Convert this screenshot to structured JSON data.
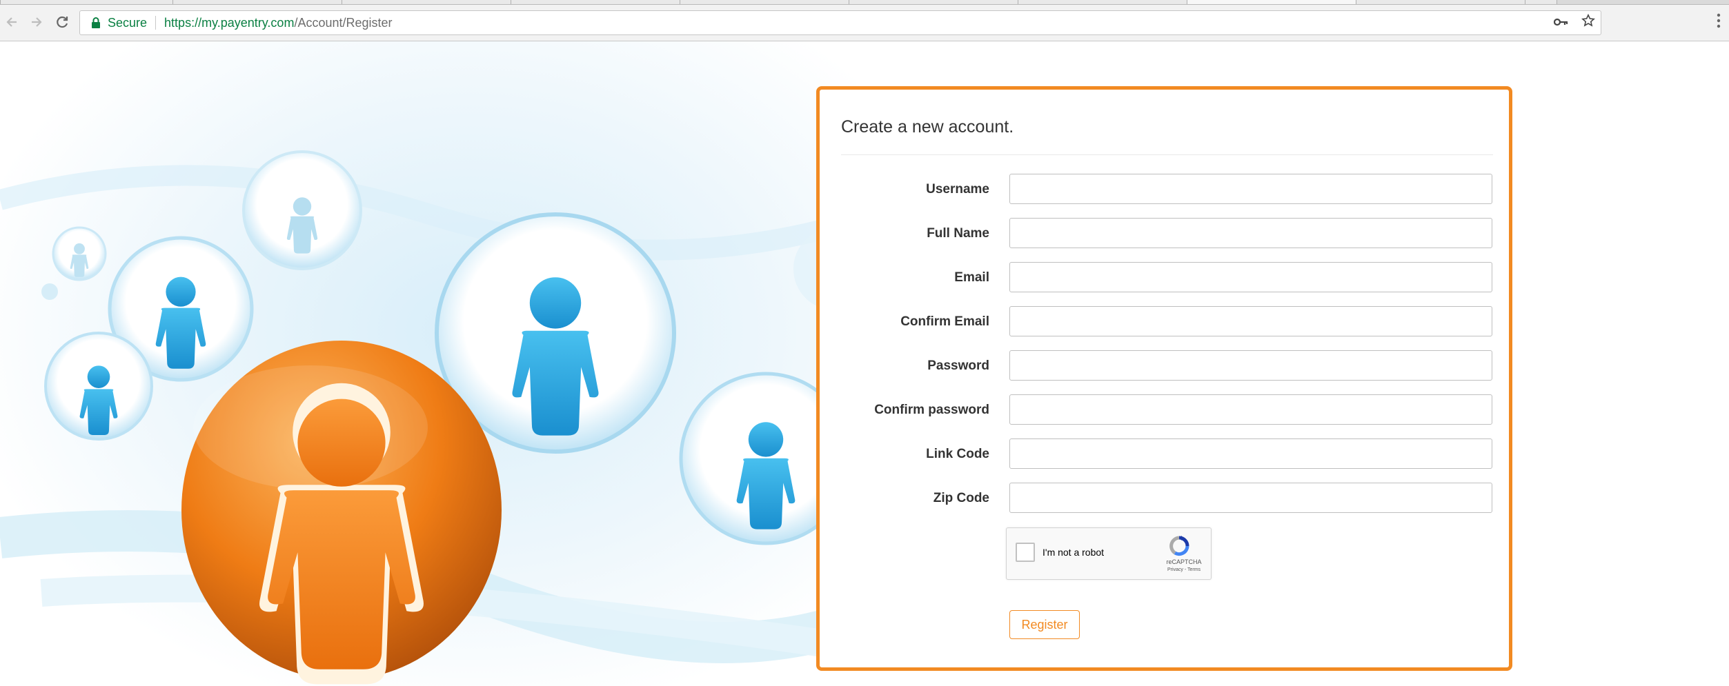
{
  "browser": {
    "secure_label": "Secure",
    "url_host": "https://my.payentry.com",
    "url_path": "/Account/Register",
    "icons": [
      "back-arrow-icon",
      "forward-arrow-icon",
      "reload-icon",
      "lock-icon",
      "key-icon",
      "star-icon",
      "menu-dots-icon"
    ]
  },
  "form": {
    "title": "Create a new account.",
    "fields": {
      "username": {
        "label": "Username",
        "value": ""
      },
      "full_name": {
        "label": "Full Name",
        "value": ""
      },
      "email": {
        "label": "Email",
        "value": ""
      },
      "confirm_email": {
        "label": "Confirm Email",
        "value": ""
      },
      "password": {
        "label": "Password",
        "value": ""
      },
      "confirm_password": {
        "label": "Confirm password",
        "value": ""
      },
      "link_code": {
        "label": "Link Code",
        "value": ""
      },
      "zip_code": {
        "label": "Zip Code",
        "value": ""
      }
    },
    "recaptcha": {
      "label": "I'm not a robot",
      "brand": "reCAPTCHA",
      "links": "Privacy - Terms",
      "checked": false
    },
    "register_label": "Register"
  },
  "colors": {
    "accent": "#f28a22",
    "secure_green": "#0b8043",
    "hero_blue": "#2aa6de"
  }
}
